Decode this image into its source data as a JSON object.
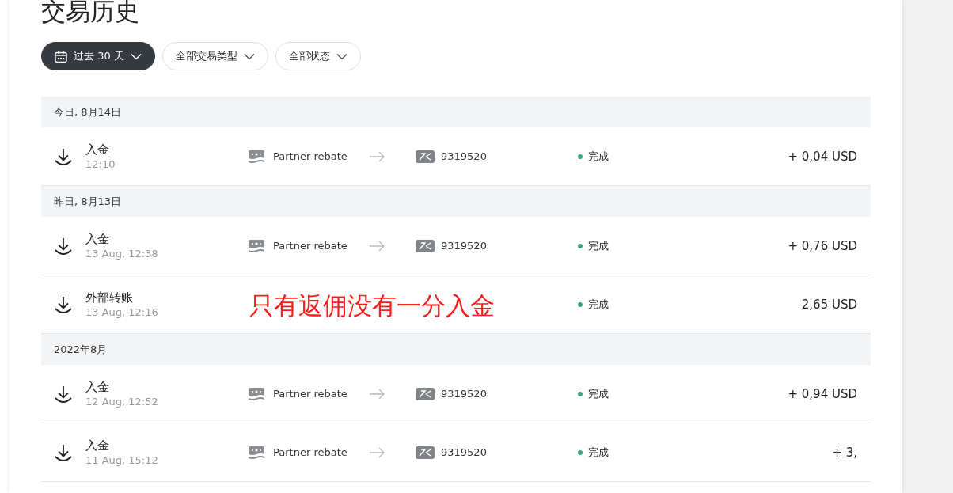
{
  "page": {
    "title": "交易历史"
  },
  "filters": [
    {
      "label": "过去 30 天",
      "selected": true,
      "kind": "date"
    },
    {
      "label": "全部交易类型",
      "selected": false,
      "kind": "type"
    },
    {
      "label": "全部状态",
      "selected": false,
      "kind": "status"
    }
  ],
  "groups": [
    {
      "date": "今日, 8月14日",
      "transactions": [
        {
          "type": "入金",
          "time": "12:10",
          "kind": "rebate",
          "source": "Partner rebate",
          "destination": "9319520",
          "status": "完成",
          "amount": "+ 0,04 USD"
        }
      ]
    },
    {
      "date": "昨日, 8月13日",
      "transactions": [
        {
          "type": "入金",
          "time": "13 Aug, 12:38",
          "kind": "rebate",
          "source": "Partner rebate",
          "destination": "9319520",
          "status": "完成",
          "amount": "+ 0,76 USD"
        },
        {
          "type": "外部转账",
          "time": "13 Aug, 12:16",
          "kind": "transfer",
          "status": "完成",
          "amount": "2,65 USD"
        }
      ]
    },
    {
      "date": "2022年8月",
      "transactions": [
        {
          "type": "入金",
          "time": "12 Aug, 12:52",
          "kind": "rebate",
          "source": "Partner rebate",
          "destination": "9319520",
          "status": "完成",
          "amount": "+ 0,94 USD"
        },
        {
          "type": "入金",
          "time": "11 Aug, 15:12",
          "kind": "rebate",
          "source": "Partner rebate",
          "destination": "9319520",
          "status": "完成",
          "amount": "+ 3,"
        }
      ]
    }
  ],
  "annotation": "只有返佣没有一分入金"
}
